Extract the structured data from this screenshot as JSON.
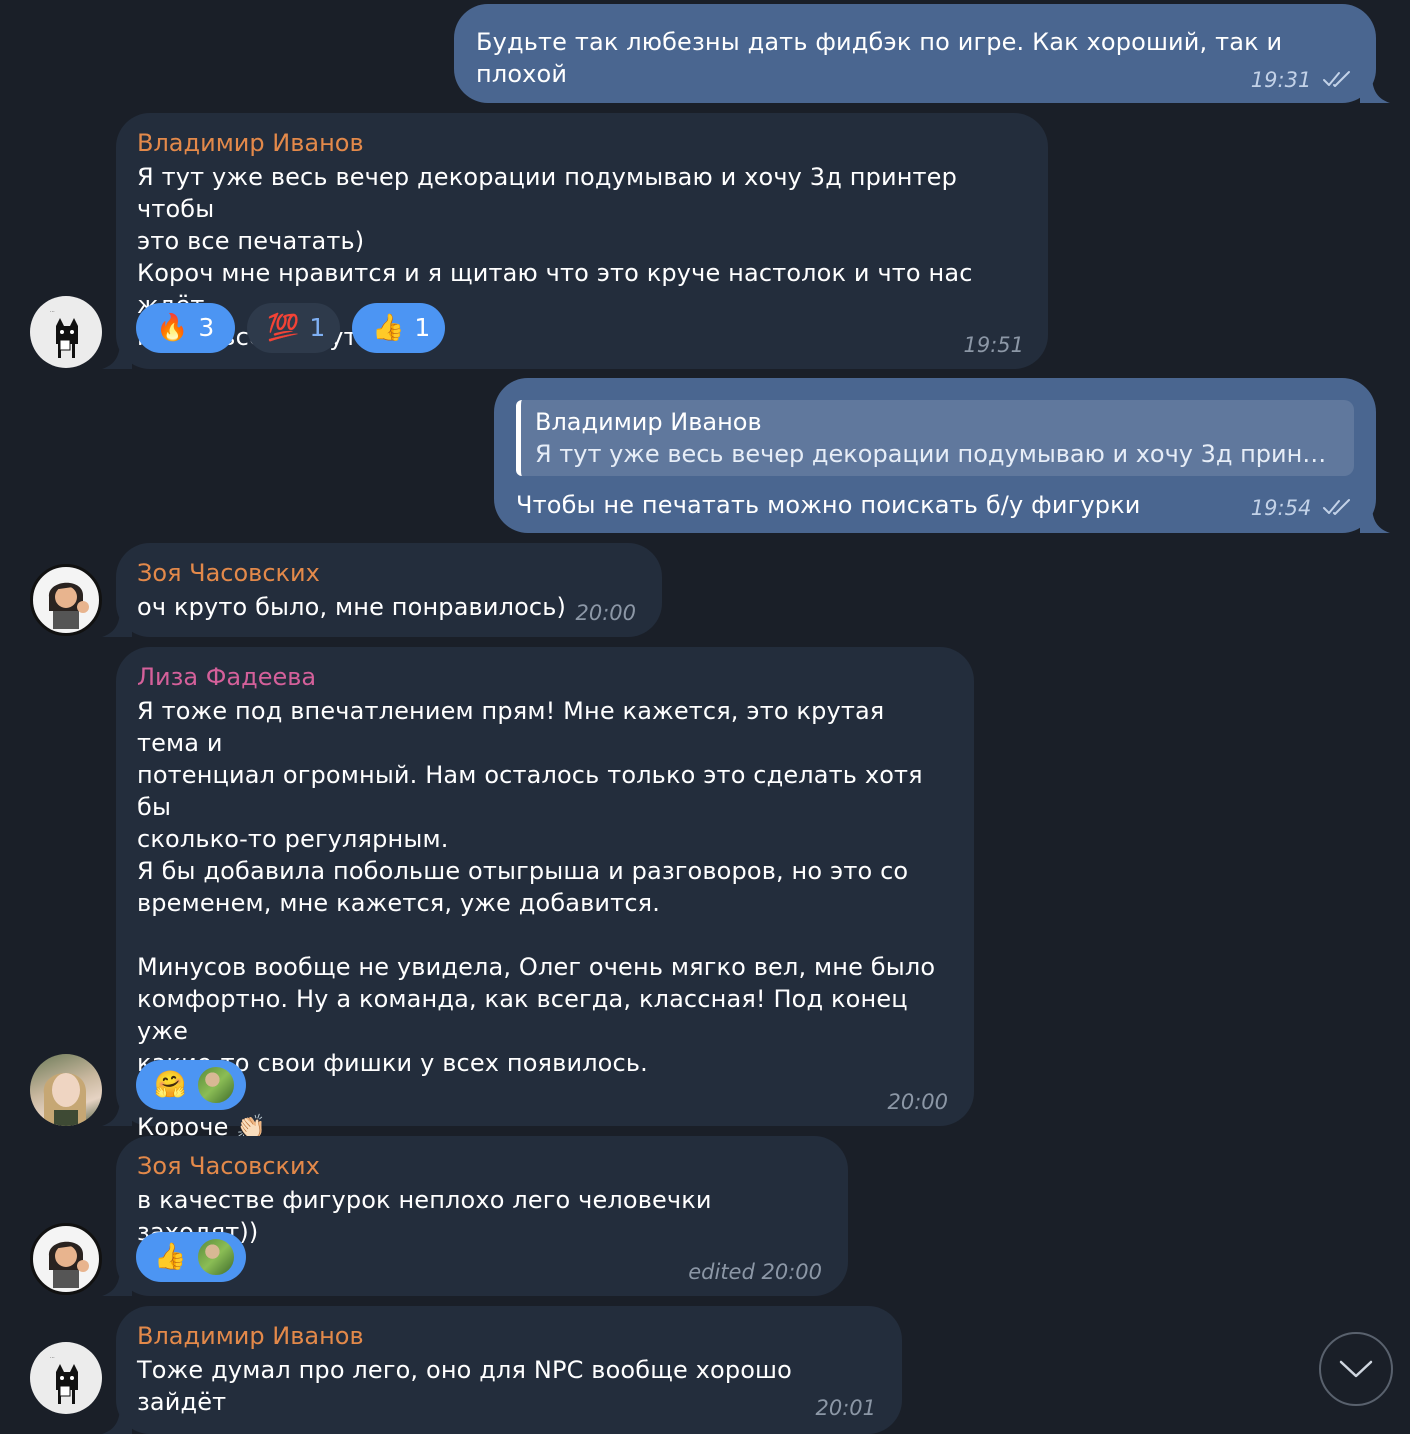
{
  "colors": {
    "background": "#1a1f28",
    "incoming_bubble": "#232d3c",
    "outgoing_bubble": "#4a6690",
    "name_orange": "#e3894a",
    "name_pink": "#d4609a",
    "reaction_blue": "#4c95f3"
  },
  "messages": [
    {
      "text": "Будьте так любезны дать фидбэк по игре. Как хороший, так и плохой",
      "time": "19:31"
    },
    {
      "sender": "Владимир Иванов",
      "text": "Я тут уже весь вечер декорации подумываю и хочу 3д принтер чтобы\nэто все печатать)\nКороч мне нравится и я щитаю что это круче настолок и что нас ждёт\nмного всего крутого",
      "time": "19:51",
      "reactions": [
        {
          "emoji": "🔥",
          "count": "3",
          "icon": "fire-icon"
        },
        {
          "emoji": "💯",
          "count": "1",
          "icon": "hundred-icon"
        },
        {
          "emoji": "👍",
          "count": "1",
          "icon": "thumbs-up-icon"
        }
      ]
    },
    {
      "reply_name": "Владимир Иванов",
      "reply_text": "Я тут уже весь вечер декорации подумываю и хочу 3д принте...",
      "text": "Чтобы не печатать можно поискать б/у фигурки",
      "time": "19:54"
    },
    {
      "sender": "Зоя Часовских",
      "text": "оч круто было, мне понравилось)",
      "time": "20:00"
    },
    {
      "sender": "Лиза Фадеева",
      "text": "Я тоже под впечатлением прям! Мне кажется, это крутая тема и\nпотенциал огромный. Нам осталось только это сделать хотя бы\nсколько-то регулярным.\nЯ бы добавила побольше отыгрыша и разговоров, но это со\nвременем, мне кажется, уже добавится.\n\nМинусов вообще не увидела, Олег очень мягко вел, мне было\nкомфортно. Ну а команда, как всегда, классная! Под конец уже\nкакие-то свои фишки у всех появилось.\n\nКороче 👏🏻",
      "time": "20:00",
      "reaction": {
        "emoji": "🤗",
        "icon": "hugging-face-icon"
      }
    },
    {
      "sender": "Зоя Часовских",
      "text": "в качестве фигурок неплохо лего человечки заходят))",
      "time": "edited 20:00",
      "reaction": {
        "emoji": "👍",
        "icon": "thumbs-up-icon"
      }
    },
    {
      "sender": "Владимир Иванов",
      "text": "Тоже думал про лего, оно для NPC вообще хорошо зайдёт",
      "time": "20:01"
    }
  ]
}
